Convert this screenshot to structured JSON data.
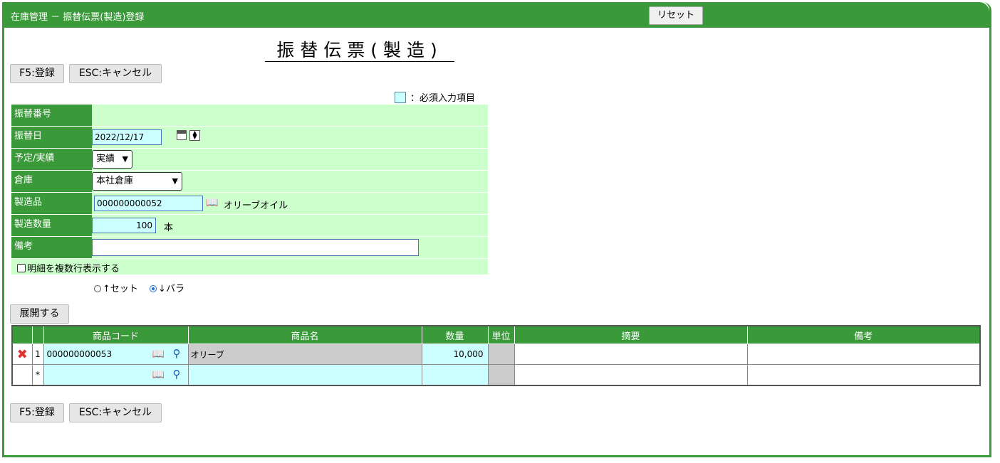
{
  "app": {
    "title": "在庫管理 － 振替伝票(製造)登録",
    "reset_label": "リセット"
  },
  "page_title": "振替伝票(製造)",
  "toolbar": {
    "register_label": "F5:登録",
    "cancel_label": "ESC:キャンセル"
  },
  "required_note": "：必須入力項目",
  "form": {
    "transfer_no_label": "振替番号",
    "transfer_no_value": "",
    "transfer_date_label": "振替日",
    "transfer_date_value": "2022/12/17",
    "plan_actual_label": "予定/実績",
    "plan_actual_value": "実績",
    "warehouse_label": "倉庫",
    "warehouse_value": "本社倉庫",
    "product_label": "製造品",
    "product_code": "000000000052",
    "product_name": "オリーブオイル",
    "quantity_label": "製造数量",
    "quantity_value": "100",
    "quantity_unit": "本",
    "memo_label": "備考",
    "memo_value": "",
    "multi_row_label": "明細を複数行表示する",
    "radio_set_label": "↑セット",
    "radio_bara_label": "↓バラ",
    "radio_selected": "バラ"
  },
  "expand_label": "展開する",
  "table": {
    "headers": [
      "商品コード",
      "商品名",
      "数量",
      "単位",
      "摘要",
      "備考"
    ],
    "rows": [
      {
        "no": "1",
        "code": "000000000053",
        "name": "オリーブ",
        "qty": "10,000",
        "unit": "",
        "summary": "",
        "memo": ""
      },
      {
        "no": "*",
        "code": "",
        "name": "",
        "qty": "",
        "unit": "",
        "summary": "",
        "memo": ""
      }
    ]
  },
  "colors": {
    "header_green": "#3a9a3a",
    "form_bg": "#ccffcc",
    "input_cyan": "#ccffff",
    "readonly_gray": "#cccccc"
  }
}
